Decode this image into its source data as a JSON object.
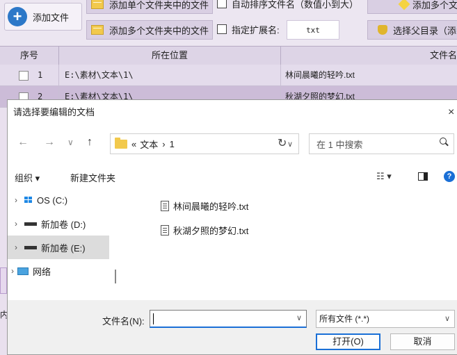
{
  "app": {
    "add_file_label": "添加文件",
    "btn_add_single_folder": "添加单个文件夹中的文件",
    "btn_add_multi_folder": "添加多个文件夹中的文件",
    "chk_auto_sort": "自动排序文件名（数值小到大）",
    "chk_ext": "指定扩展名:",
    "ext_value": "txt",
    "btn_add_multi_right": "添加多个文",
    "btn_select_parent": "选择父目录（添",
    "columns": {
      "index": "序号",
      "location": "所在位置",
      "filename": "文件名"
    },
    "rows": [
      {
        "index": "1",
        "location": "E:\\素材\\文本\\1\\",
        "filename": "林间晨曦的轻吟.txt"
      },
      {
        "index": "2",
        "location": "E:\\素材\\文本\\1\\",
        "filename": "秋湖夕照的梦幻.txt"
      }
    ],
    "side_char": "内"
  },
  "dialog": {
    "title": "请选择要编辑的文档",
    "close": "×",
    "nav": {
      "back": "←",
      "forward": "→",
      "recent": "∨",
      "up": "↑"
    },
    "address": {
      "prefix": "«",
      "part1": "文本",
      "sep": "›",
      "part2": "1"
    },
    "refresh": "↻",
    "search_placeholder": "在 1 中搜索",
    "organize": "组织 ▾",
    "new_folder": "新建文件夹",
    "view_icon": "☷ ▾",
    "help": "?",
    "tree": [
      {
        "label": "OS (C:)",
        "icon": "windows-drive-icon"
      },
      {
        "label": "新加卷 (D:)",
        "icon": "drive-icon"
      },
      {
        "label": "新加卷 (E:)",
        "icon": "drive-icon",
        "selected": true
      },
      {
        "label": "网络",
        "icon": "network-icon"
      }
    ],
    "files": [
      "林间晨曦的轻吟.txt",
      "秋湖夕照的梦幻.txt"
    ],
    "filename_label": "文件名(N):",
    "filename_value": "",
    "filetype": "所有文件 (*.*)",
    "open_btn": "打开(O)",
    "cancel_btn": "取消"
  },
  "colors": {
    "accent": "#1a6fd6",
    "app_bg": "#e9e0ee"
  }
}
